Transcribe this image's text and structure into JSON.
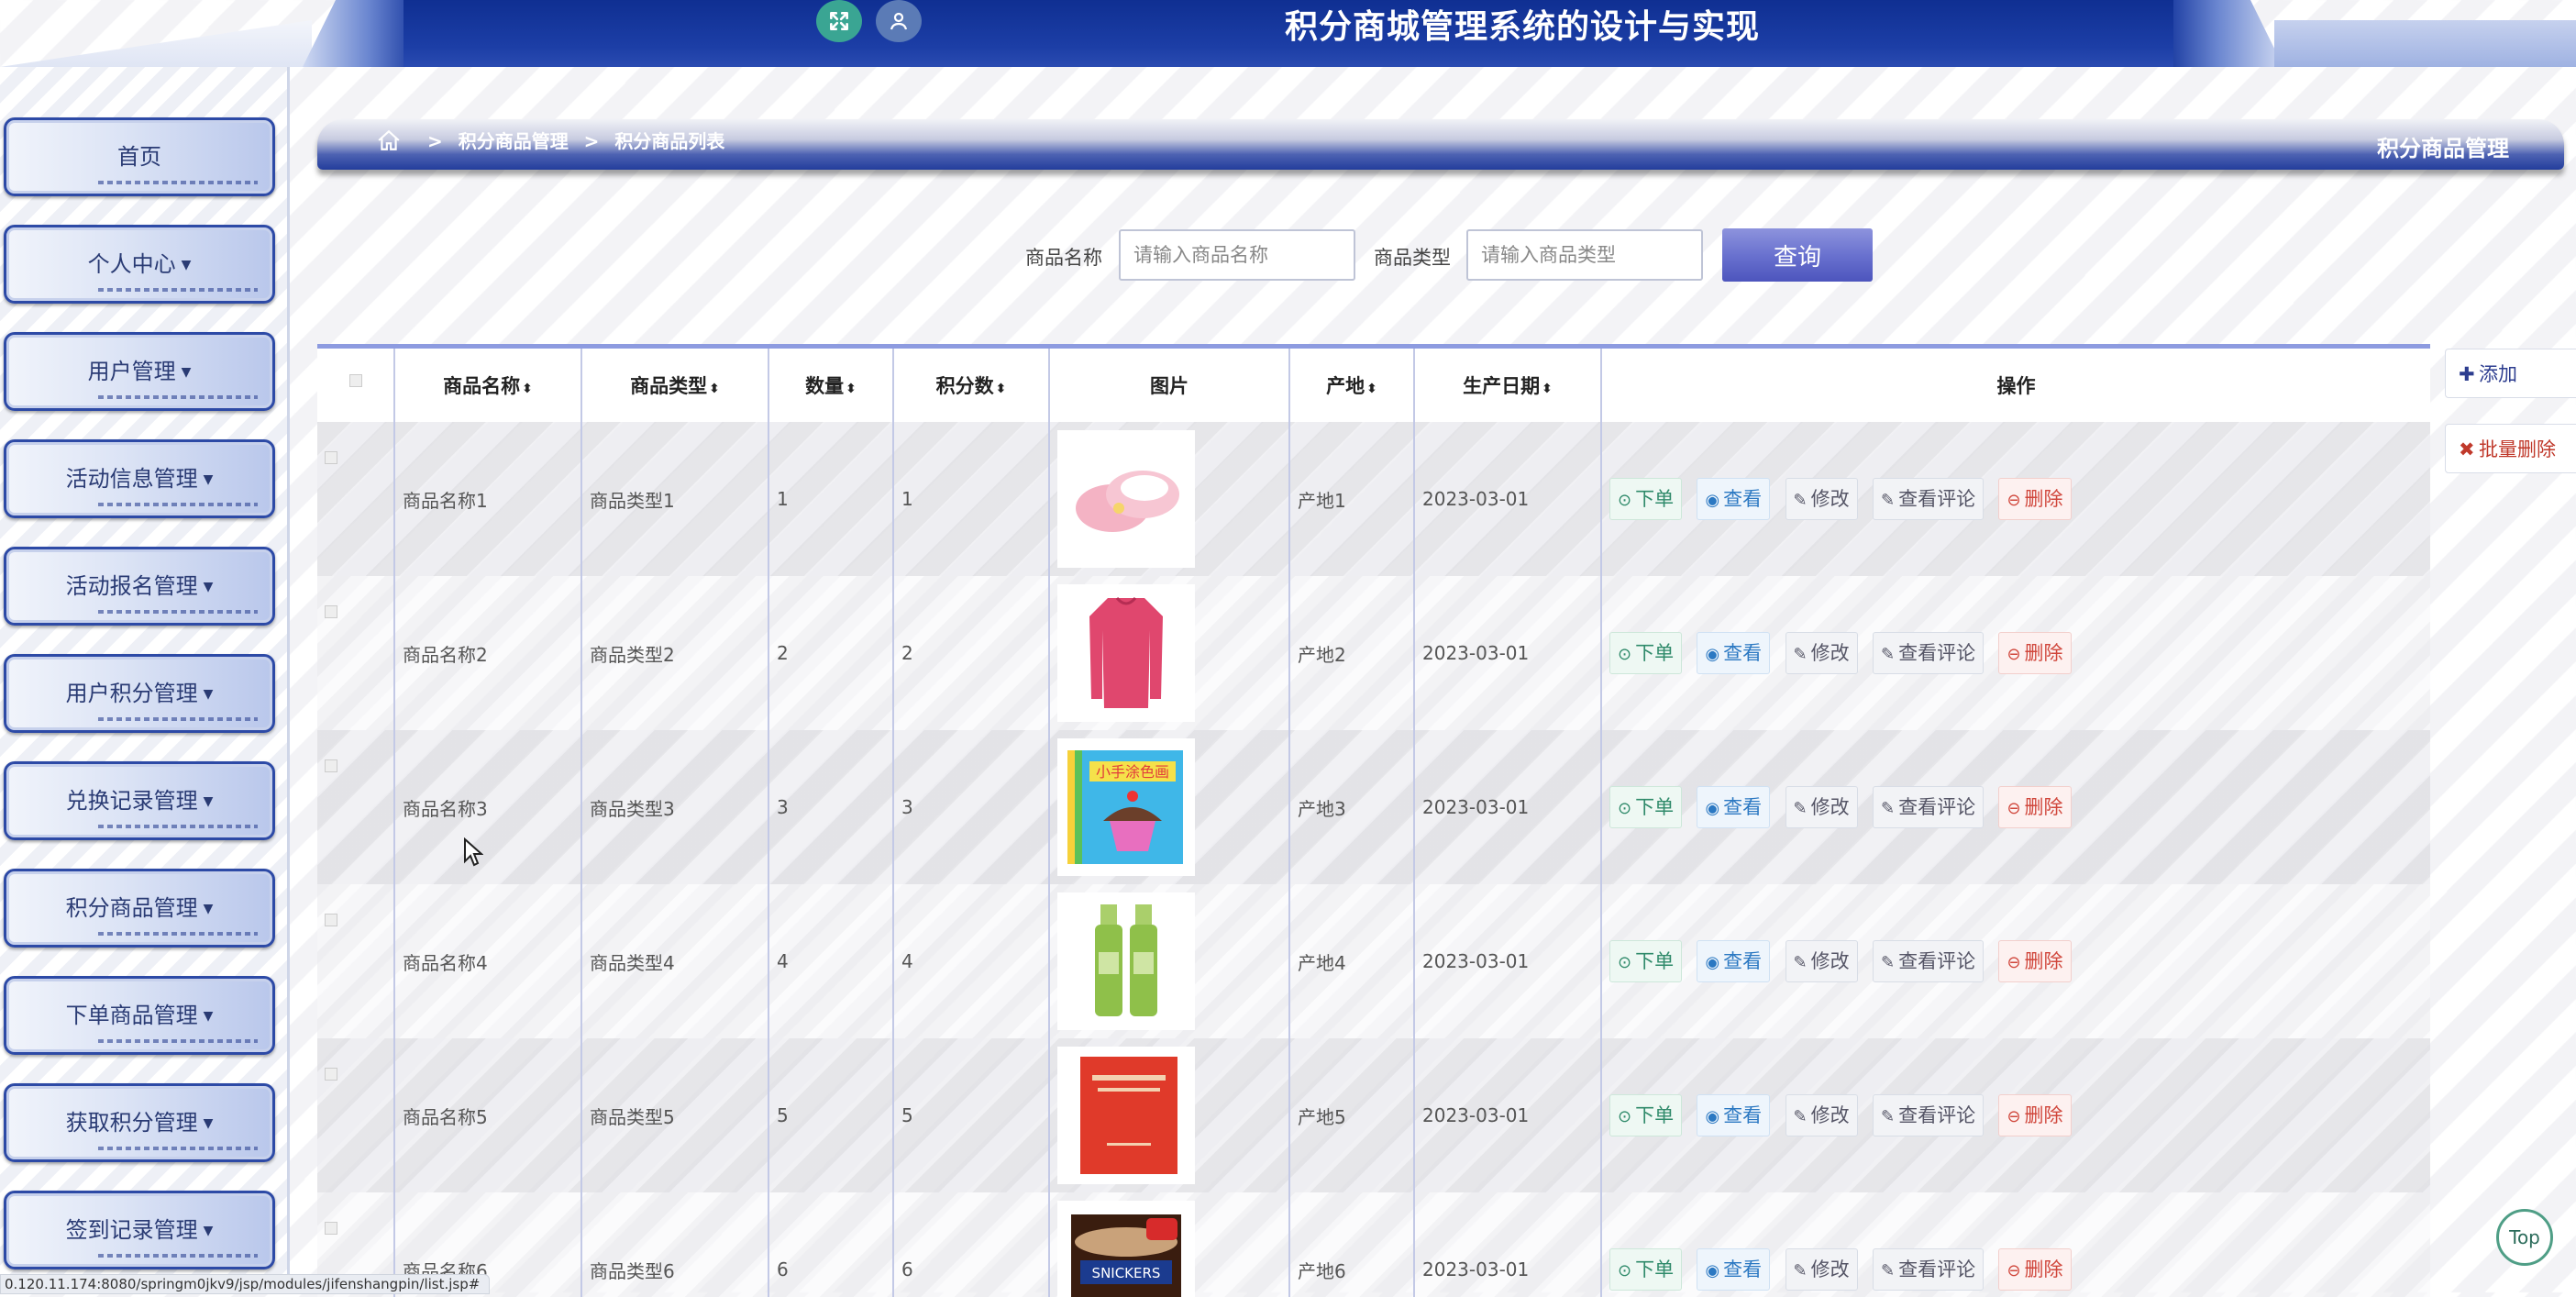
{
  "header": {
    "title": "积分商城管理系统的设计与实现",
    "icons": [
      "expand-icon",
      "user-icon"
    ]
  },
  "sidebar": {
    "items": [
      {
        "label": "首页",
        "dropdown": false
      },
      {
        "label": "个人中心",
        "dropdown": true
      },
      {
        "label": "用户管理",
        "dropdown": true
      },
      {
        "label": "活动信息管理",
        "dropdown": true
      },
      {
        "label": "活动报名管理",
        "dropdown": true
      },
      {
        "label": "用户积分管理",
        "dropdown": true
      },
      {
        "label": "兑换记录管理",
        "dropdown": true
      },
      {
        "label": "积分商品管理",
        "dropdown": true
      },
      {
        "label": "下单商品管理",
        "dropdown": true
      },
      {
        "label": "获取积分管理",
        "dropdown": true
      },
      {
        "label": "签到记录管理",
        "dropdown": true
      }
    ]
  },
  "breadcrumb": {
    "sep": ">",
    "items": [
      "积分商品管理",
      "积分商品列表"
    ],
    "right_title": "积分商品管理"
  },
  "search": {
    "name_label": "商品名称",
    "name_placeholder": "请输入商品名称",
    "type_label": "商品类型",
    "type_placeholder": "请输入商品类型",
    "button": "查询"
  },
  "actions": {
    "add": "添加",
    "batch_delete": "批量删除"
  },
  "table": {
    "headers": {
      "name": "商品名称",
      "type": "商品类型",
      "qty": "数量",
      "points": "积分数",
      "image": "图片",
      "origin": "产地",
      "date": "生产日期",
      "ops": "操作"
    },
    "sortable_glyph": "⬍",
    "ops": {
      "order": "下单",
      "view": "查看",
      "edit": "修改",
      "review": "查看评论",
      "delete": "删除"
    },
    "rows": [
      {
        "name": "商品名称1",
        "type": "商品类型1",
        "qty": "1",
        "points": "1",
        "image": "slippers-image",
        "origin": "产地1",
        "date": "2023-03-01"
      },
      {
        "name": "商品名称2",
        "type": "商品类型2",
        "qty": "2",
        "points": "2",
        "image": "sweater-image",
        "origin": "产地2",
        "date": "2023-03-01"
      },
      {
        "name": "商品名称3",
        "type": "商品类型3",
        "qty": "3",
        "points": "3",
        "image": "coloring-book-image",
        "origin": "产地3",
        "date": "2023-03-01"
      },
      {
        "name": "商品名称4",
        "type": "商品类型4",
        "qty": "4",
        "points": "4",
        "image": "cosmetics-bottles-image",
        "origin": "产地4",
        "date": "2023-03-01"
      },
      {
        "name": "商品名称5",
        "type": "商品类型5",
        "qty": "5",
        "points": "5",
        "image": "red-book-image",
        "origin": "产地5",
        "date": "2023-03-01"
      },
      {
        "name": "商品名称6",
        "type": "商品类型6",
        "qty": "6",
        "points": "6",
        "image": "snack-tub-image",
        "origin": "产地6",
        "date": "2023-03-01"
      }
    ]
  },
  "misc": {
    "top_button": "Top",
    "status_url": "0.120.11.174:8080/springm0jkv9/jsp/modules/jifenshangpin/list.jsp#"
  },
  "colors": {
    "header_blue": "#1c3ea6",
    "sidebar_border": "#2d4aa6",
    "search_button": "#6a72cf",
    "order_green": "#2f8a6a",
    "view_blue": "#2b78c2",
    "delete_red": "#d0463b"
  }
}
